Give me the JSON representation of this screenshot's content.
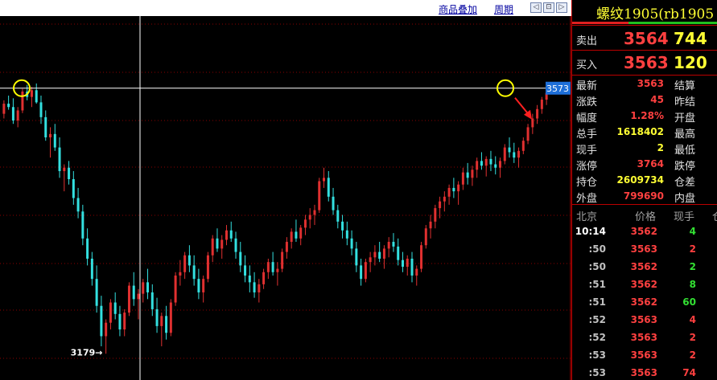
{
  "toolbar": {
    "overlay_label": "商品叠加",
    "period_label": "周期",
    "nav_buttons": [
      "◁",
      "⊡",
      "▷"
    ]
  },
  "chart_data": {
    "type": "candlestick",
    "price_tag": "3573",
    "low_label": "3179→",
    "low_value": 3179,
    "reference_price": 3573,
    "colors": {
      "up": "#e03030",
      "down": "#33e0e0",
      "background": "#000000"
    },
    "ylim": [
      3140,
      3680
    ],
    "grid": true,
    "candles_ohlc": [
      [
        3535,
        3555,
        3528,
        3550
      ],
      [
        3550,
        3562,
        3541,
        3545
      ],
      [
        3545,
        3558,
        3520,
        3525
      ],
      [
        3525,
        3545,
        3515,
        3540
      ],
      [
        3540,
        3572,
        3536,
        3568
      ],
      [
        3568,
        3578,
        3555,
        3560
      ],
      [
        3560,
        3575,
        3545,
        3570
      ],
      [
        3570,
        3580,
        3550,
        3552
      ],
      [
        3552,
        3562,
        3520,
        3530
      ],
      [
        3530,
        3540,
        3495,
        3500
      ],
      [
        3500,
        3515,
        3470,
        3505
      ],
      [
        3505,
        3520,
        3480,
        3485
      ],
      [
        3485,
        3500,
        3440,
        3450
      ],
      [
        3450,
        3460,
        3420,
        3455
      ],
      [
        3455,
        3465,
        3430,
        3438
      ],
      [
        3438,
        3450,
        3400,
        3410
      ],
      [
        3410,
        3425,
        3380,
        3390
      ],
      [
        3390,
        3400,
        3340,
        3350
      ],
      [
        3350,
        3365,
        3310,
        3320
      ],
      [
        3320,
        3330,
        3280,
        3290
      ],
      [
        3290,
        3310,
        3240,
        3250
      ],
      [
        3250,
        3265,
        3190,
        3205
      ],
      [
        3205,
        3230,
        3179,
        3225
      ],
      [
        3225,
        3260,
        3215,
        3255
      ],
      [
        3255,
        3270,
        3230,
        3238
      ],
      [
        3238,
        3250,
        3205,
        3215
      ],
      [
        3215,
        3245,
        3205,
        3240
      ],
      [
        3240,
        3285,
        3235,
        3280
      ],
      [
        3280,
        3300,
        3250,
        3260
      ],
      [
        3260,
        3275,
        3230,
        3268
      ],
      [
        3268,
        3290,
        3255,
        3285
      ],
      [
        3285,
        3305,
        3260,
        3270
      ],
      [
        3270,
        3282,
        3235,
        3245
      ],
      [
        3245,
        3262,
        3210,
        3220
      ],
      [
        3220,
        3240,
        3190,
        3235
      ],
      [
        3235,
        3250,
        3200,
        3210
      ],
      [
        3210,
        3260,
        3205,
        3255
      ],
      [
        3255,
        3300,
        3250,
        3295
      ],
      [
        3295,
        3318,
        3280,
        3300
      ],
      [
        3300,
        3330,
        3290,
        3325
      ],
      [
        3325,
        3340,
        3300,
        3310
      ],
      [
        3310,
        3325,
        3280,
        3290
      ],
      [
        3290,
        3305,
        3260,
        3270
      ],
      [
        3270,
        3295,
        3255,
        3290
      ],
      [
        3290,
        3330,
        3285,
        3325
      ],
      [
        3325,
        3355,
        3315,
        3350
      ],
      [
        3350,
        3365,
        3330,
        3335
      ],
      [
        3335,
        3355,
        3320,
        3348
      ],
      [
        3348,
        3370,
        3340,
        3362
      ],
      [
        3362,
        3375,
        3345,
        3350
      ],
      [
        3350,
        3360,
        3320,
        3330
      ],
      [
        3330,
        3345,
        3300,
        3310
      ],
      [
        3310,
        3325,
        3285,
        3295
      ],
      [
        3295,
        3310,
        3270,
        3285
      ],
      [
        3285,
        3300,
        3262,
        3270
      ],
      [
        3270,
        3290,
        3255,
        3282
      ],
      [
        3282,
        3305,
        3275,
        3300
      ],
      [
        3300,
        3320,
        3290,
        3315
      ],
      [
        3315,
        3330,
        3295,
        3300
      ],
      [
        3300,
        3315,
        3280,
        3305
      ],
      [
        3305,
        3335,
        3300,
        3330
      ],
      [
        3330,
        3352,
        3320,
        3345
      ],
      [
        3345,
        3365,
        3335,
        3360
      ],
      [
        3360,
        3378,
        3345,
        3350
      ],
      [
        3350,
        3370,
        3340,
        3366
      ],
      [
        3366,
        3385,
        3355,
        3378
      ],
      [
        3378,
        3395,
        3365,
        3385
      ],
      [
        3385,
        3400,
        3370,
        3392
      ],
      [
        3392,
        3440,
        3388,
        3435
      ],
      [
        3435,
        3455,
        3425,
        3440
      ],
      [
        3440,
        3450,
        3405,
        3412
      ],
      [
        3412,
        3425,
        3385,
        3392
      ],
      [
        3392,
        3400,
        3365,
        3375
      ],
      [
        3375,
        3385,
        3350,
        3362
      ],
      [
        3362,
        3375,
        3340,
        3350
      ],
      [
        3350,
        3362,
        3325,
        3335
      ],
      [
        3335,
        3345,
        3300,
        3310
      ],
      [
        3310,
        3320,
        3280,
        3290
      ],
      [
        3290,
        3320,
        3285,
        3315
      ],
      [
        3315,
        3330,
        3300,
        3322
      ],
      [
        3322,
        3340,
        3310,
        3330
      ],
      [
        3330,
        3345,
        3315,
        3320
      ],
      [
        3320,
        3340,
        3305,
        3335
      ],
      [
        3335,
        3352,
        3322,
        3345
      ],
      [
        3345,
        3358,
        3330,
        3338
      ],
      [
        3338,
        3350,
        3310,
        3318
      ],
      [
        3318,
        3330,
        3300,
        3308
      ],
      [
        3308,
        3325,
        3295,
        3320
      ],
      [
        3320,
        3330,
        3285,
        3295
      ],
      [
        3295,
        3310,
        3280,
        3305
      ],
      [
        3305,
        3345,
        3300,
        3340
      ],
      [
        3340,
        3370,
        3335,
        3365
      ],
      [
        3365,
        3385,
        3350,
        3375
      ],
      [
        3375,
        3400,
        3365,
        3395
      ],
      [
        3395,
        3412,
        3380,
        3405
      ],
      [
        3405,
        3420,
        3390,
        3412
      ],
      [
        3412,
        3430,
        3400,
        3425
      ],
      [
        3425,
        3440,
        3410,
        3420
      ],
      [
        3420,
        3435,
        3400,
        3430
      ],
      [
        3430,
        3455,
        3422,
        3448
      ],
      [
        3448,
        3462,
        3430,
        3440
      ],
      [
        3440,
        3458,
        3428,
        3452
      ],
      [
        3452,
        3470,
        3440,
        3465
      ],
      [
        3465,
        3478,
        3452,
        3458
      ],
      [
        3458,
        3472,
        3442,
        3468
      ],
      [
        3468,
        3480,
        3450,
        3460
      ],
      [
        3460,
        3472,
        3445,
        3455
      ],
      [
        3455,
        3470,
        3440,
        3465
      ],
      [
        3465,
        3490,
        3460,
        3485
      ],
      [
        3485,
        3500,
        3470,
        3478
      ],
      [
        3478,
        3492,
        3462,
        3470
      ],
      [
        3470,
        3485,
        3455,
        3480
      ],
      [
        3480,
        3500,
        3475,
        3495
      ],
      [
        3495,
        3520,
        3490,
        3515
      ],
      [
        3515,
        3535,
        3505,
        3528
      ],
      [
        3528,
        3548,
        3520,
        3542
      ],
      [
        3542,
        3560,
        3535,
        3556
      ],
      [
        3556,
        3575,
        3548,
        3566
      ]
    ]
  },
  "quote": {
    "title": "螺纹1905(rb1905",
    "sell_label": "卖出",
    "sell_price": "3564",
    "sell_vol": "744",
    "buy_label": "买入",
    "buy_price": "3563",
    "buy_vol": "120",
    "stats": [
      {
        "label": "最新",
        "value": "3563",
        "label2": "结算",
        "color": "#ff4040"
      },
      {
        "label": "涨跌",
        "value": "45",
        "label2": "昨结",
        "color": "#ff4040"
      },
      {
        "label": "幅度",
        "value": "1.28%",
        "label2": "开盘",
        "color": "#ff4040"
      },
      {
        "label": "总手",
        "value": "1618402",
        "label2": "最高",
        "color": "#ffff33"
      },
      {
        "label": "现手",
        "value": "2",
        "label2": "最低",
        "color": "#ffff33"
      },
      {
        "label": "涨停",
        "value": "3764",
        "label2": "跌停",
        "color": "#ff4040"
      },
      {
        "label": "持仓",
        "value": "2609734",
        "label2": "仓差",
        "color": "#ffff33"
      },
      {
        "label": "外盘",
        "value": "799690",
        "label2": "内盘",
        "color": "#ff4040"
      }
    ],
    "ticks_header": {
      "time": "北京",
      "price": "价格",
      "vol": "现手",
      "extra": "仓"
    },
    "ticks": [
      {
        "time": "10:14",
        "price": "3562",
        "vol": "4",
        "vol_color": "#33e033"
      },
      {
        "time": ":50",
        "price": "3563",
        "vol": "2",
        "vol_color": "#ff4040"
      },
      {
        "time": ":50",
        "price": "3562",
        "vol": "2",
        "vol_color": "#33e033"
      },
      {
        "time": ":51",
        "price": "3562",
        "vol": "8",
        "vol_color": "#33e033"
      },
      {
        "time": ":51",
        "price": "3562",
        "vol": "60",
        "vol_color": "#33e033"
      },
      {
        "time": ":52",
        "price": "3563",
        "vol": "4",
        "vol_color": "#ff4040"
      },
      {
        "time": ":52",
        "price": "3563",
        "vol": "2",
        "vol_color": "#ff4040"
      },
      {
        "time": ":53",
        "price": "3563",
        "vol": "2",
        "vol_color": "#ff4040"
      },
      {
        "time": ":53",
        "price": "3563",
        "vol": "74",
        "vol_color": "#ff4040"
      }
    ]
  }
}
